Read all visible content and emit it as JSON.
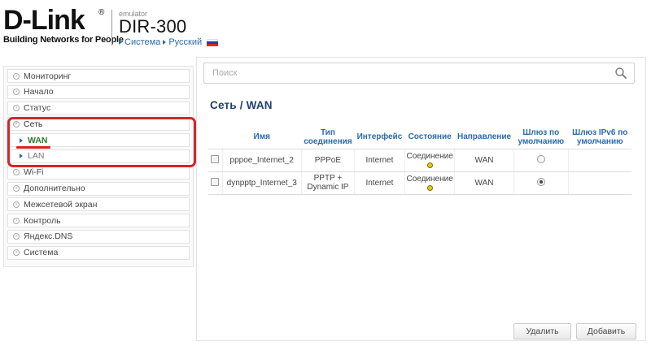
{
  "header": {
    "logo_text": "D-Link",
    "logo_reg": "®",
    "tagline": "Building Networks for People",
    "emulator_label": "emulator",
    "model": "DIR-300",
    "crumb_system": "Система",
    "crumb_language": "Русский"
  },
  "sidebar": {
    "items": [
      {
        "label": "Мониторинг"
      },
      {
        "label": "Начало"
      },
      {
        "label": "Статус"
      },
      {
        "label": "Сеть"
      },
      {
        "label": "Wi-Fi"
      },
      {
        "label": "Дополнительно"
      },
      {
        "label": "Межсетевой экран"
      },
      {
        "label": "Контроль"
      },
      {
        "label": "Яндекс.DNS"
      },
      {
        "label": "Система"
      }
    ],
    "network_subitems": [
      {
        "label": "WAN",
        "selected": true
      },
      {
        "label": "LAN",
        "selected": false
      }
    ]
  },
  "main": {
    "search_placeholder": "Поиск",
    "title": "Сеть /  WAN",
    "table": {
      "headers": [
        "Имя",
        "Тип соединения",
        "Интерфейс",
        "Состояние",
        "Направление",
        "Шлюз по умолчанию",
        "Шлюз IPv6 по умолчанию"
      ],
      "rows": [
        {
          "name": "pppoe_Internet_2",
          "type": "PPPoE",
          "interface": "Internet",
          "state": "Соединение",
          "direction": "WAN",
          "default_gw": false
        },
        {
          "name": "dynpptp_Internet_3",
          "type": "PPTP + Dynamic IP",
          "interface": "Internet",
          "state": "Соединение",
          "direction": "WAN",
          "default_gw": true
        }
      ]
    },
    "buttons": {
      "delete": "Удалить",
      "add": "Добавить"
    }
  },
  "colors": {
    "accent_blue": "#2a6ab0",
    "selected_green": "#2a7a2a",
    "highlight_red": "#d8232a",
    "status_yellow": "#f1c40f"
  },
  "icons": {
    "search": "search-icon",
    "nav_bullet": "circle-chevron-icon",
    "sub_bullet": "triangle-right-icon"
  }
}
